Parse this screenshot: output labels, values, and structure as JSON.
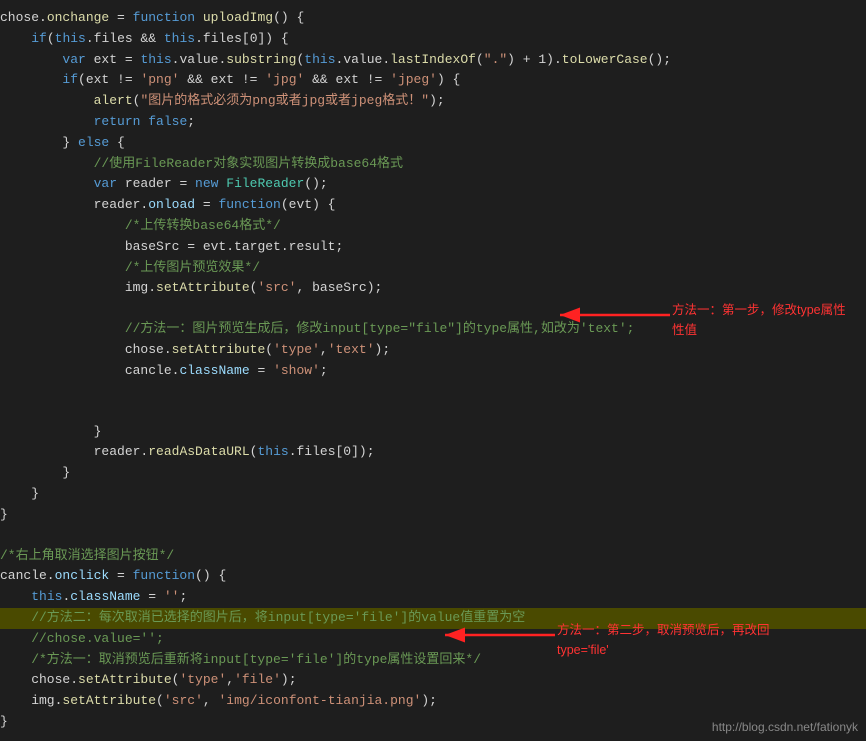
{
  "lines": [
    {
      "num": "",
      "content": [
        {
          "t": "plain",
          "v": "chose."
        },
        {
          "t": "fn",
          "v": "onchange"
        },
        {
          "t": "plain",
          "v": " = "
        },
        {
          "t": "kw",
          "v": "function"
        },
        {
          "t": "plain",
          "v": " "
        },
        {
          "t": "fn",
          "v": "uploadImg"
        },
        {
          "t": "plain",
          "v": "() {"
        }
      ],
      "highlighted": false
    },
    {
      "num": "",
      "content": [
        {
          "t": "plain",
          "v": "    "
        },
        {
          "t": "kw",
          "v": "if"
        },
        {
          "t": "plain",
          "v": "("
        },
        {
          "t": "kw",
          "v": "this"
        },
        {
          "t": "plain",
          "v": ".files && "
        },
        {
          "t": "kw",
          "v": "this"
        },
        {
          "t": "plain",
          "v": ".files[0]) {"
        }
      ],
      "highlighted": false
    },
    {
      "num": "",
      "content": [
        {
          "t": "plain",
          "v": "        "
        },
        {
          "t": "kw",
          "v": "var"
        },
        {
          "t": "plain",
          "v": " ext = "
        },
        {
          "t": "kw",
          "v": "this"
        },
        {
          "t": "plain",
          "v": ".value."
        },
        {
          "t": "fn",
          "v": "substring"
        },
        {
          "t": "plain",
          "v": "("
        },
        {
          "t": "kw",
          "v": "this"
        },
        {
          "t": "plain",
          "v": ".value."
        },
        {
          "t": "fn",
          "v": "lastIndexOf"
        },
        {
          "t": "plain",
          "v": "("
        },
        {
          "t": "str",
          "v": "\".\""
        },
        {
          "t": "plain",
          "v": ") + 1)."
        },
        {
          "t": "fn",
          "v": "toLowerCase"
        },
        {
          "t": "plain",
          "v": "();"
        }
      ],
      "highlighted": false
    },
    {
      "num": "",
      "content": [
        {
          "t": "plain",
          "v": "        "
        },
        {
          "t": "kw",
          "v": "if"
        },
        {
          "t": "plain",
          "v": "(ext != "
        },
        {
          "t": "str",
          "v": "'png'"
        },
        {
          "t": "plain",
          "v": " && ext != "
        },
        {
          "t": "str",
          "v": "'jpg'"
        },
        {
          "t": "plain",
          "v": " && ext != "
        },
        {
          "t": "str",
          "v": "'jpeg'"
        },
        {
          "t": "plain",
          "v": ") {"
        }
      ],
      "highlighted": false
    },
    {
      "num": "",
      "content": [
        {
          "t": "plain",
          "v": "            "
        },
        {
          "t": "fn",
          "v": "alert"
        },
        {
          "t": "plain",
          "v": "("
        },
        {
          "t": "str",
          "v": "\"图片的格式必须为png或者jpg或者jpeg格式！\""
        },
        {
          "t": "plain",
          "v": ");"
        }
      ],
      "highlighted": false
    },
    {
      "num": "",
      "content": [
        {
          "t": "plain",
          "v": "            "
        },
        {
          "t": "kw",
          "v": "return"
        },
        {
          "t": "plain",
          "v": " "
        },
        {
          "t": "bool-val",
          "v": "false"
        },
        {
          "t": "plain",
          "v": ";"
        }
      ],
      "highlighted": false
    },
    {
      "num": "",
      "content": [
        {
          "t": "plain",
          "v": "        } "
        },
        {
          "t": "kw",
          "v": "else"
        },
        {
          "t": "plain",
          "v": " {"
        }
      ],
      "highlighted": false
    },
    {
      "num": "",
      "content": [
        {
          "t": "cmt",
          "v": "            //使用FileReader对象实现图片转换成base64格式"
        }
      ],
      "highlighted": false
    },
    {
      "num": "",
      "content": [
        {
          "t": "plain",
          "v": "            "
        },
        {
          "t": "kw",
          "v": "var"
        },
        {
          "t": "plain",
          "v": " reader = "
        },
        {
          "t": "kw",
          "v": "new"
        },
        {
          "t": "plain",
          "v": " "
        },
        {
          "t": "cls",
          "v": "FileReader"
        },
        {
          "t": "plain",
          "v": "();"
        }
      ],
      "highlighted": false
    },
    {
      "num": "",
      "content": [
        {
          "t": "plain",
          "v": "            reader."
        },
        {
          "t": "prop",
          "v": "onload"
        },
        {
          "t": "plain",
          "v": " = "
        },
        {
          "t": "kw",
          "v": "function"
        },
        {
          "t": "plain",
          "v": "(evt) {"
        }
      ],
      "highlighted": false
    },
    {
      "num": "",
      "content": [
        {
          "t": "cmt",
          "v": "                /*上传转换base64格式*/"
        }
      ],
      "highlighted": false
    },
    {
      "num": "",
      "content": [
        {
          "t": "plain",
          "v": "                baseSrc = evt.target.result;"
        }
      ],
      "highlighted": false
    },
    {
      "num": "",
      "content": [
        {
          "t": "cmt",
          "v": "                /*上传图片预览效果*/"
        }
      ],
      "highlighted": false
    },
    {
      "num": "",
      "content": [
        {
          "t": "plain",
          "v": "                img."
        },
        {
          "t": "fn",
          "v": "setAttribute"
        },
        {
          "t": "plain",
          "v": "("
        },
        {
          "t": "str",
          "v": "'src'"
        },
        {
          "t": "plain",
          "v": ", baseSrc);"
        }
      ],
      "highlighted": false
    },
    {
      "num": "",
      "content": [],
      "highlighted": false
    },
    {
      "num": "",
      "content": [
        {
          "t": "cmt",
          "v": "                //方法一：图片预览生成后，修改input[type=\"file\"]的type属性,如改为'text';"
        }
      ],
      "highlighted": false
    },
    {
      "num": "",
      "content": [
        {
          "t": "plain",
          "v": "                chose."
        },
        {
          "t": "fn",
          "v": "setAttribute"
        },
        {
          "t": "plain",
          "v": "("
        },
        {
          "t": "str",
          "v": "'type'"
        },
        {
          "t": "plain",
          "v": ","
        },
        {
          "t": "str",
          "v": "'text'"
        },
        {
          "t": "plain",
          "v": ");"
        }
      ],
      "highlighted": false,
      "hasArrow1": true
    },
    {
      "num": "",
      "content": [
        {
          "t": "plain",
          "v": "                cancle."
        },
        {
          "t": "prop",
          "v": "className"
        },
        {
          "t": "plain",
          "v": " = "
        },
        {
          "t": "str",
          "v": "'show'"
        },
        {
          "t": "plain",
          "v": ";"
        }
      ],
      "highlighted": false
    },
    {
      "num": "",
      "content": [],
      "highlighted": false
    },
    {
      "num": "",
      "content": [],
      "highlighted": false
    },
    {
      "num": "",
      "content": [
        {
          "t": "plain",
          "v": "            }"
        }
      ],
      "highlighted": false
    },
    {
      "num": "",
      "content": [
        {
          "t": "plain",
          "v": "            reader."
        },
        {
          "t": "fn",
          "v": "readAsDataURL"
        },
        {
          "t": "plain",
          "v": "("
        },
        {
          "t": "kw",
          "v": "this"
        },
        {
          "t": "plain",
          "v": ".files[0]);"
        }
      ],
      "highlighted": false
    },
    {
      "num": "",
      "content": [
        {
          "t": "plain",
          "v": "        }"
        }
      ],
      "highlighted": false
    },
    {
      "num": "",
      "content": [
        {
          "t": "plain",
          "v": "    }"
        }
      ],
      "highlighted": false
    },
    {
      "num": "",
      "content": [
        {
          "t": "plain",
          "v": "}"
        }
      ],
      "highlighted": false
    },
    {
      "num": "",
      "content": [],
      "highlighted": false
    },
    {
      "num": "",
      "content": [
        {
          "t": "cmt",
          "v": "/*右上角取消选择图片按钮*/"
        }
      ],
      "highlighted": false
    },
    {
      "num": "",
      "content": [
        {
          "t": "plain",
          "v": "cancle."
        },
        {
          "t": "prop",
          "v": "onclick"
        },
        {
          "t": "plain",
          "v": " = "
        },
        {
          "t": "kw",
          "v": "function"
        },
        {
          "t": "plain",
          "v": "() {"
        }
      ],
      "highlighted": false
    },
    {
      "num": "",
      "content": [
        {
          "t": "plain",
          "v": "    "
        },
        {
          "t": "kw",
          "v": "this"
        },
        {
          "t": "plain",
          "v": "."
        },
        {
          "t": "prop",
          "v": "className"
        },
        {
          "t": "plain",
          "v": " = "
        },
        {
          "t": "str",
          "v": "''"
        },
        {
          "t": "plain",
          "v": ";"
        }
      ],
      "highlighted": false
    },
    {
      "num": "",
      "content": [
        {
          "t": "cmt",
          "v": "    //方法二：每次取消已选择的图片后，将input[type='file']的value值重置为空"
        }
      ],
      "highlighted": true
    },
    {
      "num": "",
      "content": [
        {
          "t": "cmt",
          "v": "    //chose.value='';"
        }
      ],
      "highlighted": false
    },
    {
      "num": "",
      "content": [
        {
          "t": "cmt",
          "v": "    /*方法一：取消预览后重新将input[type='file']的type属性设置回来*/"
        }
      ],
      "highlighted": false
    },
    {
      "num": "",
      "content": [
        {
          "t": "plain",
          "v": "    chose."
        },
        {
          "t": "fn",
          "v": "setAttribute"
        },
        {
          "t": "plain",
          "v": "("
        },
        {
          "t": "str",
          "v": "'type'"
        },
        {
          "t": "plain",
          "v": ","
        },
        {
          "t": "str",
          "v": "'file'"
        },
        {
          "t": "plain",
          "v": ");"
        }
      ],
      "highlighted": false,
      "hasArrow2": true
    },
    {
      "num": "",
      "content": [
        {
          "t": "plain",
          "v": "    img."
        },
        {
          "t": "fn",
          "v": "setAttribute"
        },
        {
          "t": "plain",
          "v": "("
        },
        {
          "t": "str",
          "v": "'src'"
        },
        {
          "t": "plain",
          "v": ", "
        },
        {
          "t": "str",
          "v": "'img/iconfont-tianjia.png'"
        },
        {
          "t": "plain",
          "v": ");"
        }
      ],
      "highlighted": false
    },
    {
      "num": "",
      "content": [
        {
          "t": "plain",
          "v": "}"
        }
      ],
      "highlighted": false
    }
  ],
  "annotations": {
    "arrow1": {
      "label1": "方法一：第一步，修改type属性",
      "label2": "性值"
    },
    "arrow2": {
      "label1": "方法一：第二步，取消预览后，再改回",
      "label2": "type='file'"
    }
  },
  "footer": {
    "url": "http://blog.csdn.net/fationyk"
  }
}
